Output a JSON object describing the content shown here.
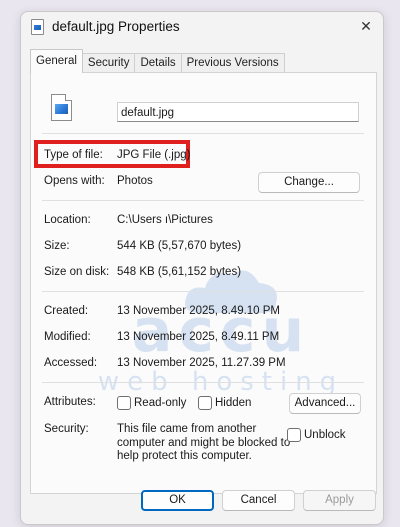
{
  "window": {
    "title": "default.jpg Properties",
    "close_glyph": "✕"
  },
  "tabs": [
    {
      "label": "General",
      "active": true
    },
    {
      "label": "Security",
      "active": false
    },
    {
      "label": "Details",
      "active": false
    },
    {
      "label": "Previous Versions",
      "active": false
    }
  ],
  "general": {
    "file_name": "default.jpg",
    "file_icon": "jpg-image-icon",
    "type_label": "Type of file:",
    "type_value": "JPG File (.jpg)",
    "opens_label": "Opens with:",
    "opens_value": "Photos",
    "change_button": "Change...",
    "location_label": "Location:",
    "location_value": "C:\\Users                ı\\Pictures",
    "size_label": "Size:",
    "size_value": "544 KB (5,57,670 bytes)",
    "size_disk_label": "Size on disk:",
    "size_disk_value": "548 KB (5,61,152 bytes)",
    "created_label": "Created:",
    "created_value": "13 November 2025, 8.49.10 PM",
    "modified_label": "Modified:",
    "modified_value": "13 November 2025, 8.49.11 PM",
    "accessed_label": "Accessed:",
    "accessed_value": "13 November 2025, 11.27.39 PM",
    "attributes_label": "Attributes:",
    "readonly_label": "Read-only",
    "readonly_checked": false,
    "hidden_label": "Hidden",
    "hidden_checked": false,
    "advanced_button": "Advanced...",
    "security_label": "Security:",
    "security_line1": "This file came from another",
    "security_line2": "computer and might be blocked to",
    "security_line3": "help protect this computer.",
    "unblock_label": "Unblock",
    "unblock_checked": false
  },
  "footer": {
    "ok": "OK",
    "cancel": "Cancel",
    "apply": "Apply"
  },
  "watermark": {
    "line1": "accu",
    "line2": "web hosting"
  },
  "colors": {
    "highlight": "#e0201e",
    "watermark": "#1f63c5",
    "ok_border": "#0067c0"
  }
}
